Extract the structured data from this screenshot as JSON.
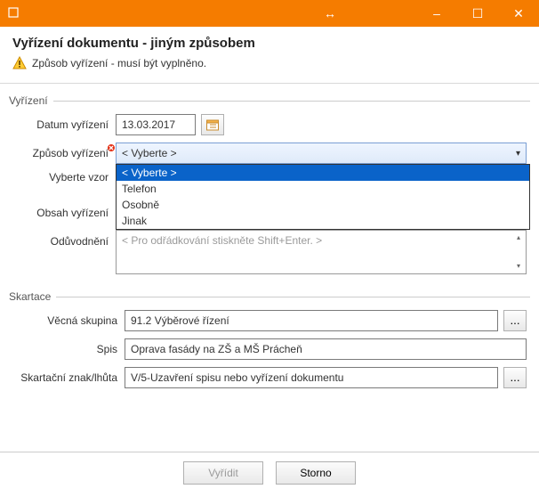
{
  "titlebar": {
    "minimize": "–",
    "maximize": "☐",
    "close": "✕",
    "resize_arrow": "↔"
  },
  "header": {
    "title": "Vyřízení dokumentu - jiným způsobem",
    "warning": "Způsob vyřízení - musí být vyplněno."
  },
  "section_vyrizeni": {
    "title": "Vyřízení",
    "datum_label": "Datum vyřízení",
    "datum_value": "13.03.2017",
    "zpusob_label": "Způsob vyřízení",
    "zpusob_selected": "< Vyberte >",
    "zpusob_options": {
      "0": "< Vyberte >",
      "1": "Telefon",
      "2": "Osobně",
      "3": "Jinak"
    },
    "vzor_label": "Vyberte vzor",
    "obsah_label": "Obsah vyřízení",
    "oduvodneni_label": "Odůvodnění",
    "oduvodneni_placeholder": "< Pro odřádkování stiskněte Shift+Enter. >"
  },
  "section_skartace": {
    "title": "Skartace",
    "vecna_label": "Věcná skupina",
    "vecna_value": "91.2 Výběrové řízení",
    "spis_label": "Spis",
    "spis_value": "Oprava fasády na ZŠ a MŠ Prácheň",
    "znak_label": "Skartační znak/lhůta",
    "znak_value": "V/5-Uzavření spisu nebo vyřízení dokumentu",
    "ellipsis": "..."
  },
  "footer": {
    "submit": "Vyřídit",
    "cancel": "Storno"
  }
}
